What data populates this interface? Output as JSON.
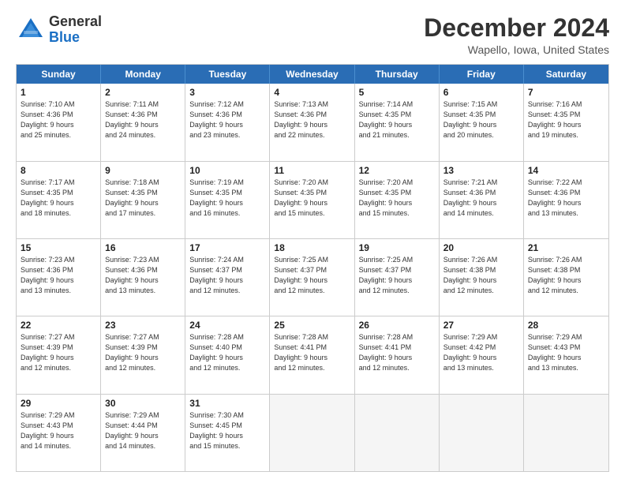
{
  "logo": {
    "general": "General",
    "blue": "Blue"
  },
  "title": "December 2024",
  "subtitle": "Wapello, Iowa, United States",
  "days": [
    "Sunday",
    "Monday",
    "Tuesday",
    "Wednesday",
    "Thursday",
    "Friday",
    "Saturday"
  ],
  "weeks": [
    [
      {
        "day": "1",
        "info": "Sunrise: 7:10 AM\nSunset: 4:36 PM\nDaylight: 9 hours\nand 25 minutes."
      },
      {
        "day": "2",
        "info": "Sunrise: 7:11 AM\nSunset: 4:36 PM\nDaylight: 9 hours\nand 24 minutes."
      },
      {
        "day": "3",
        "info": "Sunrise: 7:12 AM\nSunset: 4:36 PM\nDaylight: 9 hours\nand 23 minutes."
      },
      {
        "day": "4",
        "info": "Sunrise: 7:13 AM\nSunset: 4:36 PM\nDaylight: 9 hours\nand 22 minutes."
      },
      {
        "day": "5",
        "info": "Sunrise: 7:14 AM\nSunset: 4:35 PM\nDaylight: 9 hours\nand 21 minutes."
      },
      {
        "day": "6",
        "info": "Sunrise: 7:15 AM\nSunset: 4:35 PM\nDaylight: 9 hours\nand 20 minutes."
      },
      {
        "day": "7",
        "info": "Sunrise: 7:16 AM\nSunset: 4:35 PM\nDaylight: 9 hours\nand 19 minutes."
      }
    ],
    [
      {
        "day": "8",
        "info": "Sunrise: 7:17 AM\nSunset: 4:35 PM\nDaylight: 9 hours\nand 18 minutes."
      },
      {
        "day": "9",
        "info": "Sunrise: 7:18 AM\nSunset: 4:35 PM\nDaylight: 9 hours\nand 17 minutes."
      },
      {
        "day": "10",
        "info": "Sunrise: 7:19 AM\nSunset: 4:35 PM\nDaylight: 9 hours\nand 16 minutes."
      },
      {
        "day": "11",
        "info": "Sunrise: 7:20 AM\nSunset: 4:35 PM\nDaylight: 9 hours\nand 15 minutes."
      },
      {
        "day": "12",
        "info": "Sunrise: 7:20 AM\nSunset: 4:35 PM\nDaylight: 9 hours\nand 15 minutes."
      },
      {
        "day": "13",
        "info": "Sunrise: 7:21 AM\nSunset: 4:36 PM\nDaylight: 9 hours\nand 14 minutes."
      },
      {
        "day": "14",
        "info": "Sunrise: 7:22 AM\nSunset: 4:36 PM\nDaylight: 9 hours\nand 13 minutes."
      }
    ],
    [
      {
        "day": "15",
        "info": "Sunrise: 7:23 AM\nSunset: 4:36 PM\nDaylight: 9 hours\nand 13 minutes."
      },
      {
        "day": "16",
        "info": "Sunrise: 7:23 AM\nSunset: 4:36 PM\nDaylight: 9 hours\nand 13 minutes."
      },
      {
        "day": "17",
        "info": "Sunrise: 7:24 AM\nSunset: 4:37 PM\nDaylight: 9 hours\nand 12 minutes."
      },
      {
        "day": "18",
        "info": "Sunrise: 7:25 AM\nSunset: 4:37 PM\nDaylight: 9 hours\nand 12 minutes."
      },
      {
        "day": "19",
        "info": "Sunrise: 7:25 AM\nSunset: 4:37 PM\nDaylight: 9 hours\nand 12 minutes."
      },
      {
        "day": "20",
        "info": "Sunrise: 7:26 AM\nSunset: 4:38 PM\nDaylight: 9 hours\nand 12 minutes."
      },
      {
        "day": "21",
        "info": "Sunrise: 7:26 AM\nSunset: 4:38 PM\nDaylight: 9 hours\nand 12 minutes."
      }
    ],
    [
      {
        "day": "22",
        "info": "Sunrise: 7:27 AM\nSunset: 4:39 PM\nDaylight: 9 hours\nand 12 minutes."
      },
      {
        "day": "23",
        "info": "Sunrise: 7:27 AM\nSunset: 4:39 PM\nDaylight: 9 hours\nand 12 minutes."
      },
      {
        "day": "24",
        "info": "Sunrise: 7:28 AM\nSunset: 4:40 PM\nDaylight: 9 hours\nand 12 minutes."
      },
      {
        "day": "25",
        "info": "Sunrise: 7:28 AM\nSunset: 4:41 PM\nDaylight: 9 hours\nand 12 minutes."
      },
      {
        "day": "26",
        "info": "Sunrise: 7:28 AM\nSunset: 4:41 PM\nDaylight: 9 hours\nand 12 minutes."
      },
      {
        "day": "27",
        "info": "Sunrise: 7:29 AM\nSunset: 4:42 PM\nDaylight: 9 hours\nand 13 minutes."
      },
      {
        "day": "28",
        "info": "Sunrise: 7:29 AM\nSunset: 4:43 PM\nDaylight: 9 hours\nand 13 minutes."
      }
    ],
    [
      {
        "day": "29",
        "info": "Sunrise: 7:29 AM\nSunset: 4:43 PM\nDaylight: 9 hours\nand 14 minutes."
      },
      {
        "day": "30",
        "info": "Sunrise: 7:29 AM\nSunset: 4:44 PM\nDaylight: 9 hours\nand 14 minutes."
      },
      {
        "day": "31",
        "info": "Sunrise: 7:30 AM\nSunset: 4:45 PM\nDaylight: 9 hours\nand 15 minutes."
      },
      {
        "day": "",
        "info": ""
      },
      {
        "day": "",
        "info": ""
      },
      {
        "day": "",
        "info": ""
      },
      {
        "day": "",
        "info": ""
      }
    ]
  ]
}
